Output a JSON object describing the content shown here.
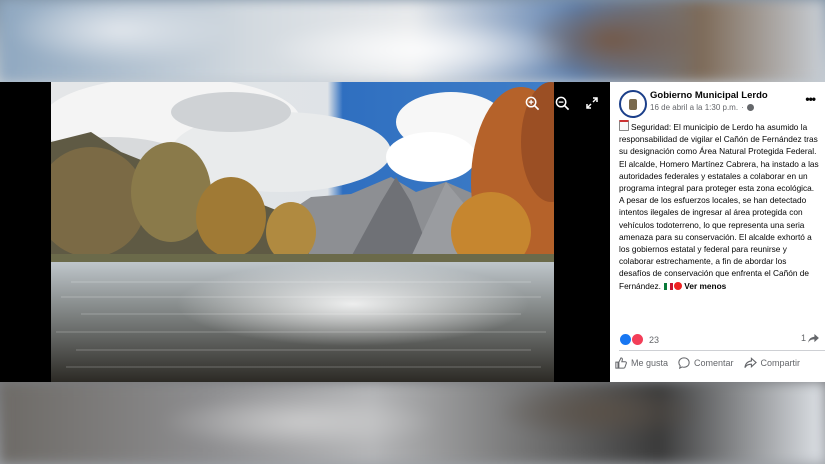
{
  "post": {
    "page_name": "Gobierno Municipal Lerdo",
    "date": "16 de abril a la 1:30 p.m.",
    "separator": "·",
    "text_before": "Seguridad: El municipio de Lerdo ha asumido la responsabilidad de vigilar el Cañón de Fernández tras su designación como Área Natural Protegida Federal. El alcalde, Homero Martínez Cabrera, ha instado a las autoridades federales y estatales a colaborar en un programa integral para proteger esta zona ecológica. A pesar de los esfuerzos locales, se han detectado intentos ilegales de ingresar al área protegida con vehículos todoterreno, lo que representa una seria amenaza para su conservación. El alcalde exhortó a los gobiernos estatal y federal para reunirse y colaborar estrechamente, a fin de abordar los desafíos de conservación que enfrenta el Cañón de Fernández.",
    "see_less": "Ver menos",
    "reaction_count": "23",
    "share_count": "1"
  },
  "actions": {
    "like": "Me gusta",
    "comment": "Comentar",
    "share": "Compartir"
  },
  "icons": {
    "zoom_in": "zoom-in-icon",
    "zoom_out": "zoom-out-icon",
    "fullscreen": "fullscreen-icon",
    "more": "more-icon"
  },
  "colors": {
    "accent": "#1877f2",
    "love": "#f33e58",
    "muted": "#65676b"
  }
}
